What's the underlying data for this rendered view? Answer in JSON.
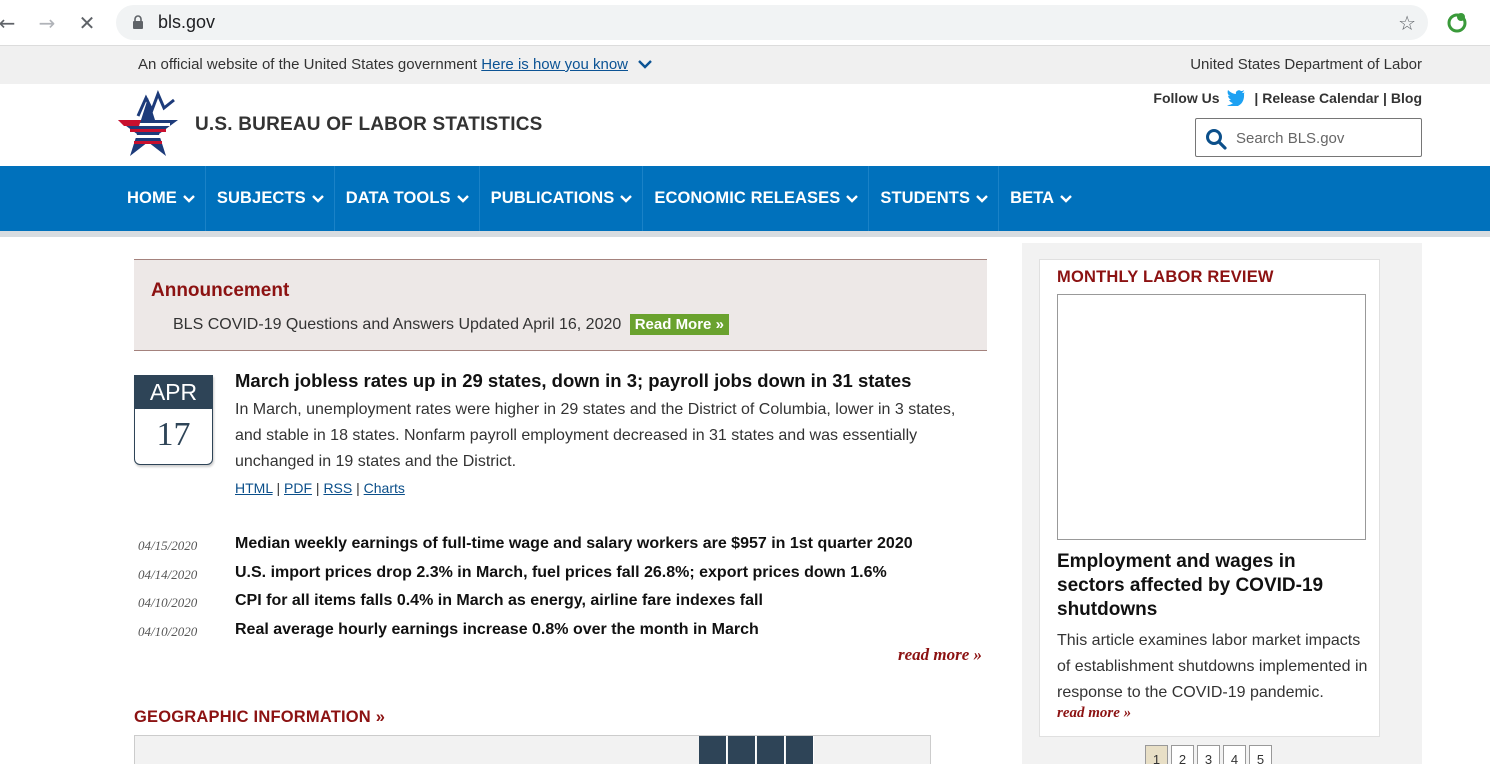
{
  "browser": {
    "url": "bls.gov"
  },
  "gov_banner": {
    "official_text": "An official website of the United States government",
    "how_you_know": "Here is how you know",
    "department": "United States Department of Labor"
  },
  "header": {
    "title": "U.S. BUREAU OF LABOR STATISTICS",
    "follow_us": "Follow Us",
    "release_calendar": "Release Calendar",
    "blog": "Blog",
    "search_placeholder": "Search BLS.gov"
  },
  "nav": {
    "items": [
      "HOME",
      "SUBJECTS",
      "DATA TOOLS",
      "PUBLICATIONS",
      "ECONOMIC RELEASES",
      "STUDENTS",
      "BETA"
    ]
  },
  "announcement": {
    "heading": "Announcement",
    "text": "BLS COVID-19 Questions and Answers Updated April 16, 2020",
    "button": "Read More »"
  },
  "featured": {
    "month": "APR",
    "day": "17",
    "title": "March jobless rates up in 29 states, down in 3; payroll jobs down in 31 states",
    "description": "In March, unemployment rates were higher in 29 states and the District of Columbia, lower in 3 states, and stable in 18 states. Nonfarm payroll employment decreased in 31 states and was essentially unchanged in 19 states and the District.",
    "links": [
      "HTML",
      "PDF",
      "RSS",
      "Charts"
    ]
  },
  "releases": [
    {
      "date": "04/15/2020",
      "title": "Median weekly earnings of full-time wage and salary workers are $957 in 1st quarter 2020"
    },
    {
      "date": "04/14/2020",
      "title": "U.S. import prices drop 2.3% in March, fuel prices fall 26.8%; export prices down 1.6%"
    },
    {
      "date": "04/10/2020",
      "title": "CPI for all items falls 0.4% in March as energy, airline fare indexes fall"
    },
    {
      "date": "04/10/2020",
      "title": "Real average hourly earnings increase 0.8% over the month in March"
    }
  ],
  "read_more": "read more »",
  "geo": {
    "heading": "GEOGRAPHIC INFORMATION »"
  },
  "sidebar": {
    "heading": "MONTHLY LABOR REVIEW",
    "title": "Employment and wages in sectors affected by COVID-19 shutdowns",
    "description": "This article examines labor market impacts of establishment shutdowns implemented in response to the COVID-19 pandemic.",
    "more": "read more »",
    "pages": [
      "1",
      "2",
      "3",
      "4",
      "5"
    ],
    "active_page": "1"
  },
  "colors": {
    "nav_blue": "#0071bc",
    "accent_red": "#8c1212",
    "button_green": "#6aa22e",
    "badge_navy": "#2e4457"
  }
}
